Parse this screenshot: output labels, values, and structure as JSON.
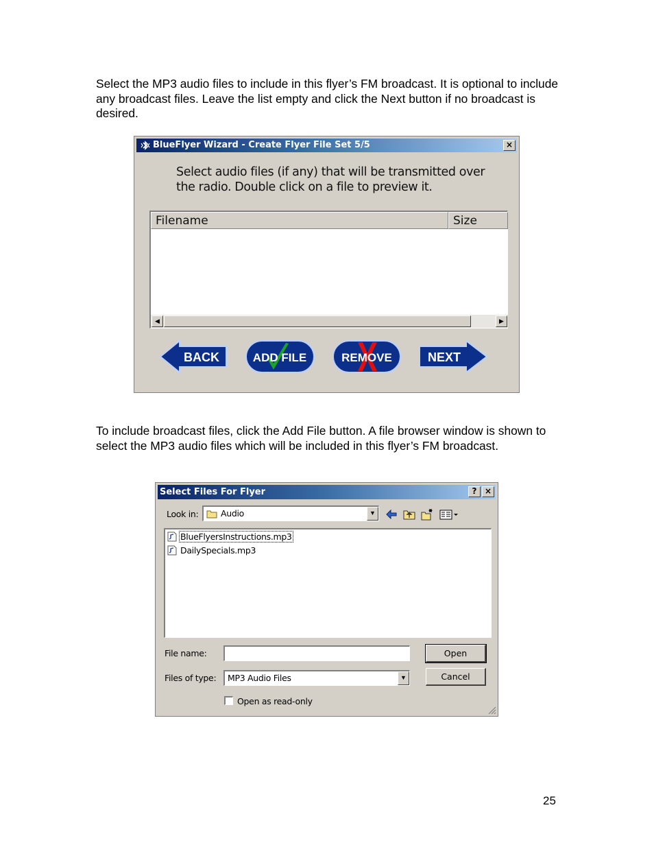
{
  "intro_paragraph": "Select the MP3 audio files to include in this flyer’s FM broadcast.  It is optional to include any broadcast files.  Leave the list empty and click the Next button if no broadcast is desired.",
  "wizard": {
    "title": "BlueFlyer Wizard - Create Flyer File Set 5/5",
    "close_label": "×",
    "instruction_line1": "Select audio files (if any) that will be transmitted over",
    "instruction_line2": "the radio. Double click on a file to preview it.",
    "columns": [
      "Filename",
      "Size"
    ],
    "scroll_left": "◀",
    "scroll_right": "▶",
    "buttons": {
      "back": "BACK",
      "add_file": "ADD FILE",
      "remove": "REMOVE",
      "next": "NEXT"
    },
    "colors": {
      "button_blue": "#0b2f8a",
      "check_green": "#1aa52a",
      "remove_red": "#e01010"
    }
  },
  "middle_paragraph": "To include broadcast files, click the Add File button.  A file browser window is shown to select the MP3 audio files which will be included in this flyer’s FM broadcast.",
  "dialog": {
    "title": "Select Files For Flyer",
    "help_label": "?",
    "close_label": "×",
    "look_in_label": "Look in:",
    "look_in_value": "Audio",
    "files": [
      "BlueFlyersInstructions.mp3",
      "DailySpecials.mp3"
    ],
    "file_name_label": "File name:",
    "file_name_value": "",
    "files_of_type_label": "Files of type:",
    "files_of_type_value": "MP3 Audio Files",
    "open_button": "Open",
    "cancel_button": "Cancel",
    "read_only_label": "Open as read-only",
    "dropdown_arrow": "▼"
  },
  "page_number": "25"
}
